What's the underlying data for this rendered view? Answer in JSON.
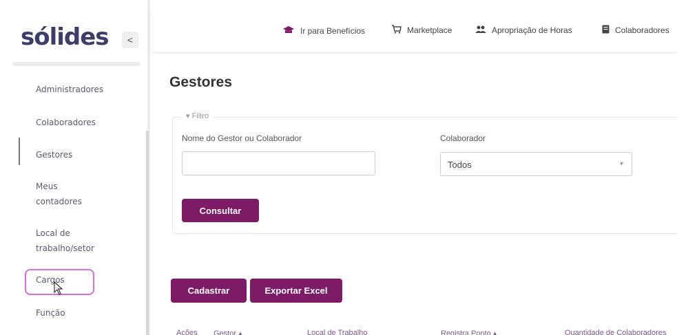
{
  "logo_text": "sólides",
  "sidebar": {
    "collapse_label": "<",
    "items": [
      {
        "label": "Administradores"
      },
      {
        "label": "Colaboradores"
      },
      {
        "label": "Gestores"
      },
      {
        "label": "Meus contadores"
      },
      {
        "label": "Local de trabalho/setor"
      },
      {
        "label": "Cargos"
      },
      {
        "label": "Função"
      }
    ]
  },
  "topbar": {
    "links": [
      {
        "label": "Ir para Benefícios",
        "icon": "graduation-cap-icon"
      },
      {
        "label": "Marketplace",
        "icon": "cart-icon"
      },
      {
        "label": "Apropriação de Horas",
        "icon": "users-icon"
      },
      {
        "label": "Colaboradores",
        "icon": "document-icon"
      }
    ]
  },
  "main": {
    "title": "Gestores",
    "filter": {
      "legend": "Filtro",
      "name_label": "Nome do Gestor ou Colaborador",
      "name_value": "",
      "collab_label": "Colaborador",
      "collab_value": "Todos",
      "submit_label": "Consultar"
    },
    "actions": {
      "create_label": "Cadastrar",
      "export_label": "Exportar Excel"
    },
    "table_headers": [
      "Ações",
      "Gestor",
      "Local de Trabalho",
      "Registra Ponto",
      "Quantidade de Colaboradores"
    ]
  },
  "colors": {
    "primary": "#7d1b67",
    "highlight": "#d76be0",
    "logo": "#3d3d6b"
  }
}
